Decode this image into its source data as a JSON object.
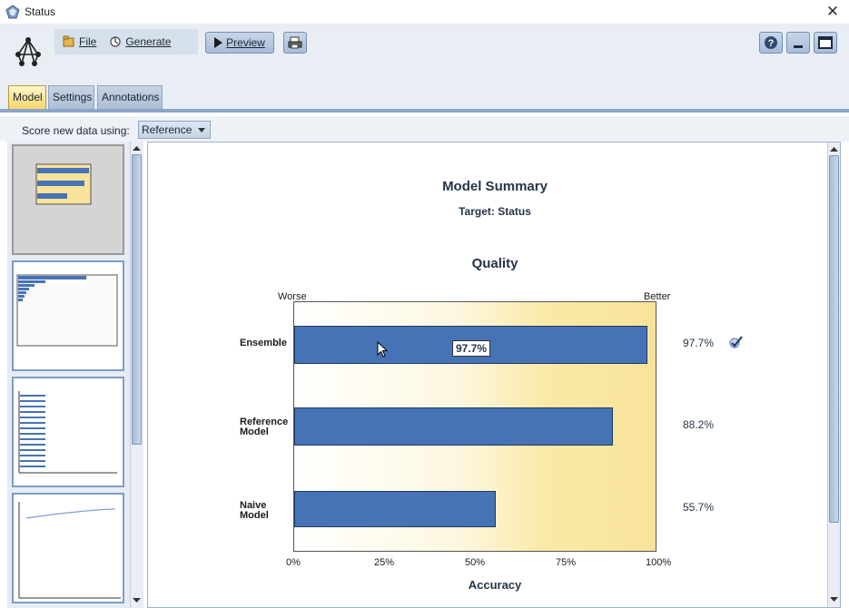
{
  "window": {
    "title": "Status"
  },
  "menu": {
    "file_label": "File",
    "generate_label": "Generate"
  },
  "toolbar": {
    "preview_label": "Preview"
  },
  "tabs": [
    "Model",
    "Settings",
    "Annotations"
  ],
  "score": {
    "label": "Score new data using:",
    "selected": "Reference"
  },
  "summary": {
    "title": "Model Summary",
    "target": "Target: Status",
    "quality_title": "Quality",
    "worse_label": "Worse",
    "better_label": "Better",
    "xlabel": "Accuracy",
    "tooltip": "97.7%"
  },
  "colors": {
    "bar": "#4673b5",
    "plot_gradient_end": "#f8e39a",
    "active_tab": "#f5d56e"
  },
  "icons": [
    "status-app-icon",
    "close-icon",
    "stream-icon",
    "file-icon",
    "generate-icon",
    "preview-play-icon",
    "print-icon",
    "help-icon",
    "minimize-icon",
    "maximize-icon",
    "checkmark-icon",
    "mouse-cursor-icon"
  ],
  "chart_data": {
    "type": "bar",
    "orientation": "horizontal",
    "title": "Quality",
    "xlabel": "Accuracy",
    "categories": [
      "Ensemble",
      "Reference Model",
      "Naive Model"
    ],
    "values": [
      97.7,
      88.2,
      55.7
    ],
    "value_labels": [
      "97.7%",
      "88.2%",
      "55.7%"
    ],
    "xlim": [
      0,
      100
    ],
    "xticks": [
      "0%",
      "25%",
      "50%",
      "75%",
      "100%"
    ],
    "grid": false,
    "legend": "none"
  }
}
